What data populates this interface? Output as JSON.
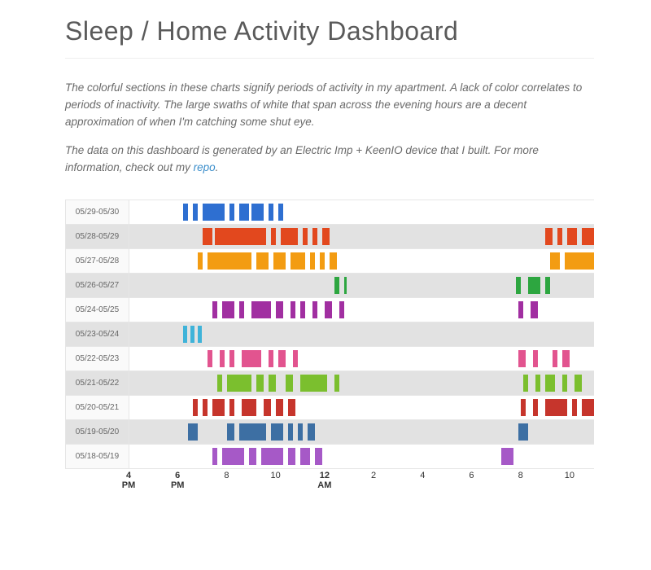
{
  "title": "Sleep / Home Activity Dashboard",
  "paragraphs": [
    "The colorful sections in these charts signify periods of activity in my apartment. A lack of color correlates to periods of inactivity. The large swaths of white that span across the evening hours are a decent approximation of when I'm catching some shut eye.",
    "The data on this dashboard is generated by an Electric Imp + KeenIO device that I built. For more information, check out my "
  ],
  "link_text": "repo",
  "link_trailer": ".",
  "chart_data": {
    "type": "timeline",
    "xlabel_unit": "hour_of_day_wrapping_4pm_to_11am",
    "x_domain_hours": [
      16,
      35
    ],
    "x_ticks": [
      {
        "hour": 16,
        "label": "4\nPM",
        "bold": true
      },
      {
        "hour": 18,
        "label": "6\nPM",
        "bold": true
      },
      {
        "hour": 20,
        "label": "8",
        "bold": false
      },
      {
        "hour": 22,
        "label": "10",
        "bold": false
      },
      {
        "hour": 24,
        "label": "12\nAM",
        "bold": true
      },
      {
        "hour": 26,
        "label": "2",
        "bold": false
      },
      {
        "hour": 28,
        "label": "4",
        "bold": false
      },
      {
        "hour": 30,
        "label": "6",
        "bold": false
      },
      {
        "hour": 32,
        "label": "8",
        "bold": false
      },
      {
        "hour": 34,
        "label": "10",
        "bold": false
      }
    ],
    "series": [
      {
        "name": "05/29-05/30",
        "color": "#2e6fd1",
        "segments": [
          [
            18.2,
            18.4
          ],
          [
            18.6,
            18.8
          ],
          [
            19.0,
            19.9
          ],
          [
            20.1,
            20.3
          ],
          [
            20.5,
            20.9
          ],
          [
            21.0,
            21.5
          ],
          [
            21.7,
            21.9
          ],
          [
            22.1,
            22.3
          ]
        ]
      },
      {
        "name": "05/28-05/29",
        "color": "#e2481e",
        "segments": [
          [
            19.0,
            19.4
          ],
          [
            19.5,
            21.6
          ],
          [
            21.8,
            22.0
          ],
          [
            22.2,
            22.9
          ],
          [
            23.1,
            23.3
          ],
          [
            23.5,
            23.7
          ],
          [
            23.9,
            24.2
          ],
          [
            33.0,
            33.3
          ],
          [
            33.5,
            33.7
          ],
          [
            33.9,
            34.3
          ],
          [
            34.5,
            35.0
          ]
        ]
      },
      {
        "name": "05/27-05/28",
        "color": "#f39c12",
        "segments": [
          [
            18.8,
            19.0
          ],
          [
            19.2,
            21.0
          ],
          [
            21.2,
            21.7
          ],
          [
            21.9,
            22.4
          ],
          [
            22.6,
            23.2
          ],
          [
            23.4,
            23.6
          ],
          [
            23.8,
            24.0
          ],
          [
            24.2,
            24.5
          ],
          [
            33.2,
            33.6
          ],
          [
            33.8,
            35.0
          ]
        ]
      },
      {
        "name": "05/26-05/27",
        "color": "#2da640",
        "segments": [
          [
            24.4,
            24.6
          ],
          [
            24.8,
            24.9
          ],
          [
            31.8,
            32.0
          ],
          [
            32.3,
            32.8
          ],
          [
            33.0,
            33.2
          ]
        ]
      },
      {
        "name": "05/24-05/25",
        "color": "#a12fa1",
        "segments": [
          [
            19.4,
            19.6
          ],
          [
            19.8,
            20.3
          ],
          [
            20.5,
            20.7
          ],
          [
            21.0,
            21.8
          ],
          [
            22.0,
            22.3
          ],
          [
            22.6,
            22.8
          ],
          [
            23.0,
            23.2
          ],
          [
            23.5,
            23.7
          ],
          [
            24.0,
            24.3
          ],
          [
            24.6,
            24.8
          ],
          [
            31.9,
            32.1
          ],
          [
            32.4,
            32.7
          ]
        ]
      },
      {
        "name": "05/23-05/24",
        "color": "#3fb3d9",
        "segments": [
          [
            18.2,
            18.35
          ],
          [
            18.5,
            18.65
          ],
          [
            18.8,
            18.95
          ]
        ]
      },
      {
        "name": "05/22-05/23",
        "color": "#e2548f",
        "segments": [
          [
            19.2,
            19.4
          ],
          [
            19.7,
            19.9
          ],
          [
            20.1,
            20.3
          ],
          [
            20.6,
            21.4
          ],
          [
            21.7,
            21.9
          ],
          [
            22.1,
            22.4
          ],
          [
            22.7,
            22.9
          ],
          [
            31.9,
            32.2
          ],
          [
            32.5,
            32.7
          ],
          [
            33.3,
            33.5
          ],
          [
            33.7,
            34.0
          ]
        ]
      },
      {
        "name": "05/21-05/22",
        "color": "#7bbf2e",
        "segments": [
          [
            19.6,
            19.8
          ],
          [
            20.0,
            21.0
          ],
          [
            21.2,
            21.5
          ],
          [
            21.7,
            22.0
          ],
          [
            22.4,
            22.7
          ],
          [
            23.0,
            24.1
          ],
          [
            24.4,
            24.6
          ],
          [
            32.1,
            32.3
          ],
          [
            32.6,
            32.8
          ],
          [
            33.0,
            33.4
          ],
          [
            33.7,
            33.9
          ],
          [
            34.2,
            34.5
          ]
        ]
      },
      {
        "name": "05/20-05/21",
        "color": "#c6352c",
        "segments": [
          [
            18.6,
            18.8
          ],
          [
            19.0,
            19.2
          ],
          [
            19.4,
            19.9
          ],
          [
            20.1,
            20.3
          ],
          [
            20.6,
            21.2
          ],
          [
            21.5,
            21.8
          ],
          [
            22.0,
            22.3
          ],
          [
            22.5,
            22.8
          ],
          [
            32.0,
            32.2
          ],
          [
            32.5,
            32.7
          ],
          [
            33.0,
            33.9
          ],
          [
            34.1,
            34.3
          ],
          [
            34.5,
            35.0
          ]
        ]
      },
      {
        "name": "05/19-05/20",
        "color": "#3d6fa3",
        "segments": [
          [
            18.4,
            18.8
          ],
          [
            20.0,
            20.3
          ],
          [
            20.5,
            21.6
          ],
          [
            21.8,
            22.3
          ],
          [
            22.5,
            22.7
          ],
          [
            22.9,
            23.1
          ],
          [
            23.3,
            23.6
          ],
          [
            31.9,
            32.3
          ]
        ]
      },
      {
        "name": "05/18-05/19",
        "color": "#a659c7",
        "segments": [
          [
            19.4,
            19.6
          ],
          [
            19.8,
            20.7
          ],
          [
            20.9,
            21.2
          ],
          [
            21.4,
            22.3
          ],
          [
            22.5,
            22.8
          ],
          [
            23.0,
            23.4
          ],
          [
            23.6,
            23.9
          ],
          [
            31.2,
            31.7
          ]
        ]
      }
    ]
  }
}
